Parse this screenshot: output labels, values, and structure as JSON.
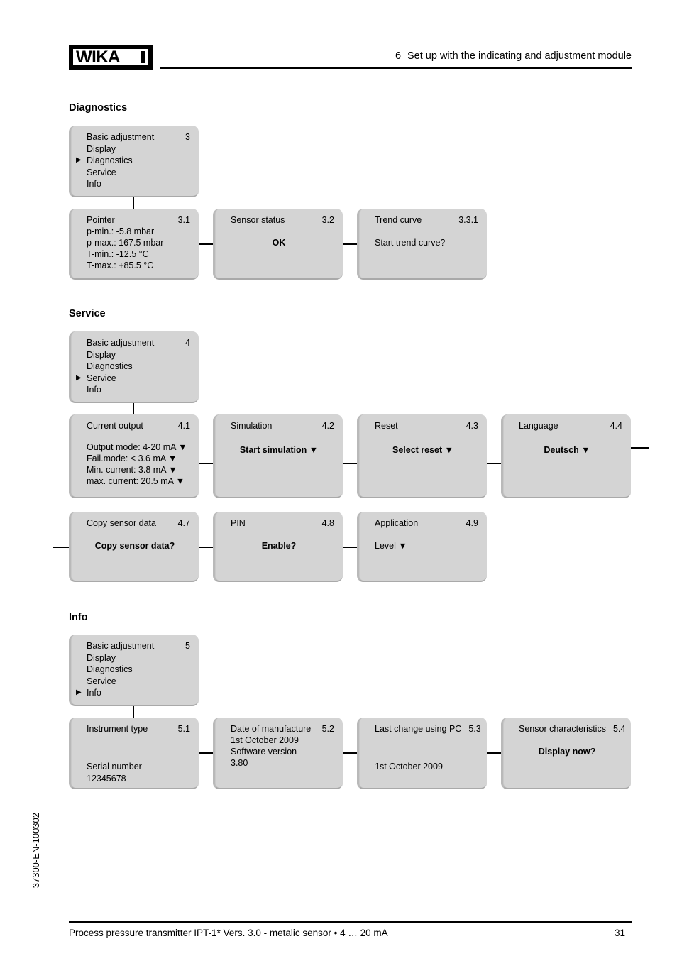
{
  "header": {
    "logo_text": "WIKA",
    "chapter_number": "6",
    "chapter_title": "Set up with the indicating and adjustment module"
  },
  "sections": [
    {
      "heading": "Diagnostics",
      "menu": {
        "index": "3",
        "items": [
          "Basic adjustment",
          "Display",
          "Diagnostics",
          "Service",
          "Info"
        ],
        "selected": "Diagnostics"
      },
      "boxes": [
        {
          "title": "Pointer",
          "index": "3.1",
          "lines": [
            "p-min.: -5.8 mbar",
            "p-max.: 167.5 mbar",
            "T-min.: -12.5 °C",
            "T-max.: +85.5 °C"
          ]
        },
        {
          "title": "Sensor status",
          "index": "3.2",
          "center_bold": "OK"
        },
        {
          "title": "Trend curve",
          "index": "3.3.1",
          "left_plain": "Start trend curve?"
        }
      ]
    },
    {
      "heading": "Service",
      "menu": {
        "index": "4",
        "items": [
          "Basic adjustment",
          "Display",
          "Diagnostics",
          "Service",
          "Info"
        ],
        "selected": "Service"
      },
      "boxes": [
        {
          "title": "Current output",
          "index": "4.1",
          "lines": [
            "Output mode: 4-20 mA ▼",
            "Fail.mode: < 3.6 mA ▼",
            "Min. current: 3.8 mA ▼",
            "max. current: 20.5 mA ▼"
          ]
        },
        {
          "title": "Simulation",
          "index": "4.2",
          "center_bold": "Start simulation ▼"
        },
        {
          "title": "Reset",
          "index": "4.3",
          "center_bold": "Select reset ▼"
        },
        {
          "title": "Language",
          "index": "4.4",
          "center_bold": "Deutsch ▼"
        },
        {
          "title": "Copy sensor data",
          "index": "4.7",
          "center_bold": "Copy sensor data?"
        },
        {
          "title": "PIN",
          "index": "4.8",
          "center_bold": "Enable?"
        },
        {
          "title": "Application",
          "index": "4.9",
          "left_plain": "Level ▼"
        }
      ]
    },
    {
      "heading": "Info",
      "menu": {
        "index": "5",
        "items": [
          "Basic adjustment",
          "Display",
          "Diagnostics",
          "Service",
          "Info"
        ],
        "selected": "Info"
      },
      "boxes": [
        {
          "title": "Instrument type",
          "index": "5.1",
          "lower_lines": [
            "Serial number",
            "12345678"
          ]
        },
        {
          "title": "Date of manufacture",
          "index": "5.2",
          "lines": [
            "1st October 2009",
            "Software version",
            "3.80"
          ]
        },
        {
          "title": "Last change using PC",
          "index": "5.3",
          "left_plain": "1st October 2009"
        },
        {
          "title": "Sensor characteristics",
          "index": "5.4",
          "center_bold_top": "Display now?"
        }
      ]
    }
  ],
  "footer": {
    "side_code": "37300-EN-100302",
    "text": "Process pressure transmitter IPT-1* Vers. 3.0 - metalic sensor • 4 … 20 mA",
    "page": "31"
  }
}
